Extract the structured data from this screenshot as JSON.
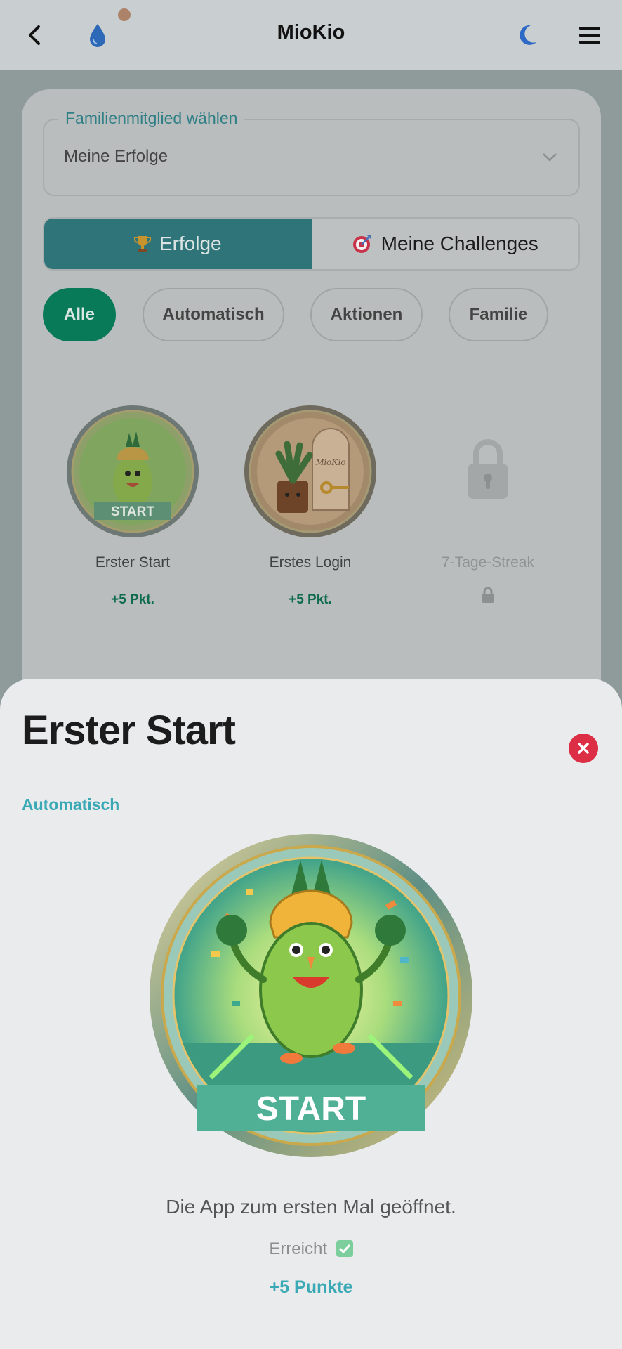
{
  "header": {
    "title": "MioKio"
  },
  "selector": {
    "legend": "Familienmitglied wählen",
    "value": "Meine Erfolge"
  },
  "tabs": [
    {
      "label": "Erfolge",
      "icon": "trophy-icon"
    },
    {
      "label": "Meine Challenges",
      "icon": "target-icon"
    }
  ],
  "filters": [
    "Alle",
    "Automatisch",
    "Aktionen",
    "Familie"
  ],
  "badges": [
    {
      "name": "Erster Start",
      "points": "+5 Pkt.",
      "medal_text": "START"
    },
    {
      "name": "Erstes Login",
      "points": "+5 Pkt.",
      "medal_text": "MioKio"
    },
    {
      "name": "7-Tage-Streak",
      "locked": true
    }
  ],
  "detail": {
    "title": "Erster Start",
    "category": "Automatisch",
    "medal_text": "START",
    "description": "Die App zum ersten Mal geöffnet.",
    "status": "Erreicht",
    "points": "+5 Punkte"
  },
  "colors": {
    "accent_teal": "#2e7479",
    "chip_active": "#087a57",
    "close_red": "#dc2e45",
    "category_text": "#3aa9b5"
  }
}
